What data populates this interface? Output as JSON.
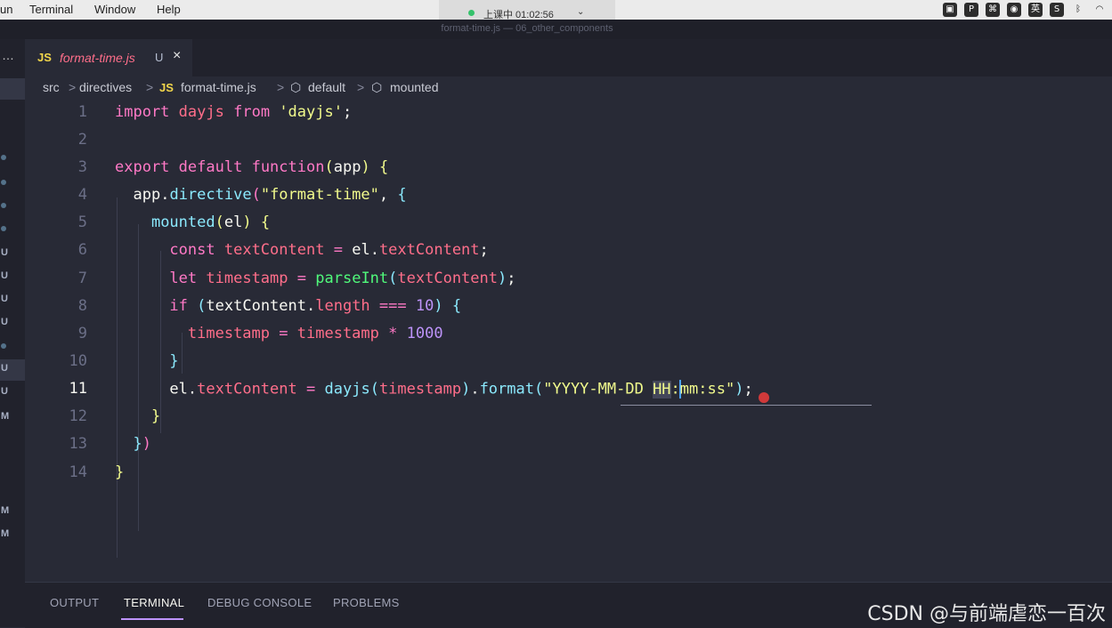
{
  "menubar": {
    "items": [
      "un",
      "Terminal",
      "Window",
      "Help"
    ],
    "recording": "上课中 01:02:56",
    "tray_icons": [
      "camera-icon",
      "p-icon",
      "grid-icon",
      "rec-icon",
      "ime-icon",
      "s-icon",
      "bluetooth-icon",
      "wifi-icon"
    ],
    "ime_label": "英"
  },
  "window": {
    "title": "format-time.js — 06_other_components"
  },
  "sidebar": {
    "more": "…",
    "marks": [
      "U",
      "U",
      "U",
      "U",
      "U",
      "U",
      "M",
      "M",
      "M"
    ]
  },
  "tab": {
    "icon": "JS",
    "name": "format-time.js",
    "status": "U",
    "close": "×"
  },
  "breadcrumb": {
    "items": [
      "src",
      "directives",
      "format-time.js",
      "default",
      "mounted"
    ],
    "separator": ">",
    "file_icon": "JS"
  },
  "editor": {
    "active_line": 11,
    "lines": [
      {
        "n": "1"
      },
      {
        "n": "2"
      },
      {
        "n": "3"
      },
      {
        "n": "4"
      },
      {
        "n": "5"
      },
      {
        "n": "6"
      },
      {
        "n": "7"
      },
      {
        "n": "8"
      },
      {
        "n": "9"
      },
      {
        "n": "10"
      },
      {
        "n": "11"
      },
      {
        "n": "12"
      },
      {
        "n": "13"
      },
      {
        "n": "14"
      }
    ],
    "tokens": {
      "l1": [
        "import",
        "dayjs",
        "from",
        "'dayjs'",
        ";"
      ],
      "l3": [
        "export",
        "default",
        "function",
        "(",
        "app",
        ")",
        "{"
      ],
      "l4": [
        "app",
        ".",
        "directive",
        "(",
        "\"format-time\"",
        ", ",
        "{"
      ],
      "l5": [
        "mounted",
        "(",
        "el",
        ")",
        "{"
      ],
      "l6": [
        "const",
        "textContent",
        "=",
        "el",
        ".",
        "textContent",
        ";"
      ],
      "l7": [
        "let",
        "timestamp",
        "=",
        "parseInt",
        "(",
        "textContent",
        ")",
        ";"
      ],
      "l8": [
        "if",
        "(",
        "textContent",
        ".",
        "length",
        "===",
        "10",
        ")",
        "{"
      ],
      "l9": [
        "timestamp",
        "=",
        "timestamp",
        "*",
        "1000"
      ],
      "l10": [
        "}"
      ],
      "l11": [
        "el",
        ".",
        "textContent",
        "=",
        "dayjs",
        "(",
        "timestamp",
        ")",
        ".",
        "format",
        "(",
        "\"YYYY-MM-DD ",
        "HH",
        ":",
        "mm:ss\"",
        ")",
        ";"
      ],
      "l12": [
        "}"
      ],
      "l13": [
        "}",
        ")"
      ],
      "l14": [
        "}"
      ]
    }
  },
  "panel": {
    "tabs": [
      "OUTPUT",
      "TERMINAL",
      "DEBUG CONSOLE",
      "PROBLEMS"
    ],
    "active": "TERMINAL"
  },
  "watermark": "CSDN @与前端虐恋一百次",
  "colors": {
    "background": "#282a36",
    "keyword": "#ff79c6",
    "string": "#f1fa8c",
    "function": "#50fa7b",
    "number": "#bd93f9"
  }
}
